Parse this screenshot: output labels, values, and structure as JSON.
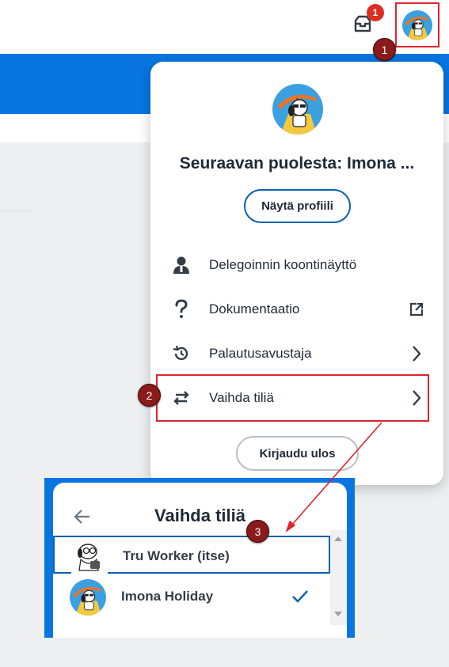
{
  "header": {
    "notification_count": "1"
  },
  "callouts": [
    "1",
    "2",
    "3"
  ],
  "profile_menu": {
    "name": "Seuraavan puolesta: Imona ...",
    "view_profile_label": "Näytä profiili",
    "items": [
      {
        "label": "Delegoinnin koontinäyttö",
        "icon": "person-icon"
      },
      {
        "label": "Dokumentaatio",
        "icon": "help-icon",
        "trailing": "external-link-icon"
      },
      {
        "label": "Palautusavustaja",
        "icon": "history-icon",
        "trailing": "chevron-right-icon"
      },
      {
        "label": "Vaihda tiliä",
        "icon": "swap-icon",
        "trailing": "chevron-right-icon"
      }
    ],
    "logout_label": "Kirjaudu ulos"
  },
  "switch_panel": {
    "title": "Vaihda tiliä",
    "accounts": [
      {
        "name": "Tru Worker (itse)",
        "selected_outline": true
      },
      {
        "name": "Imona Holiday",
        "current": true
      }
    ]
  },
  "colors": {
    "brand_blue": "#0875e1",
    "callout_red": "#8b1a1a",
    "highlight_red": "#e0232e",
    "badge_red": "#de2e21"
  }
}
